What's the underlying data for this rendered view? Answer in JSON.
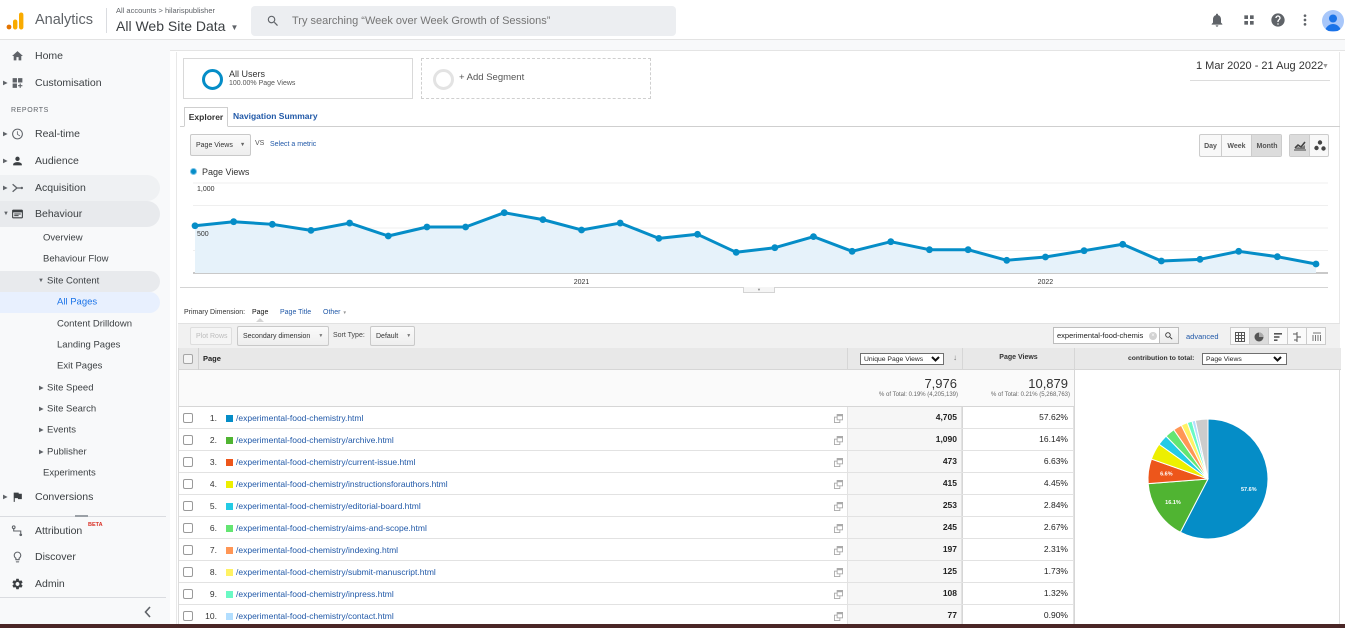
{
  "header": {
    "app_name": "Analytics",
    "breadcrumb": "All accounts > hilarispublisher",
    "property": "All Web Site Data",
    "search_placeholder": "Try searching “Week over Week Growth of Sessions”"
  },
  "sidebar": {
    "items": {
      "home": "Home",
      "customisation": "Customisation",
      "reports_heading": "REPORTS",
      "realtime": "Real-time",
      "audience": "Audience",
      "acquisition": "Acquisition",
      "behaviour": "Behaviour",
      "overview": "Overview",
      "behaviour_flow": "Behaviour Flow",
      "site_content": "Site Content",
      "all_pages": "All Pages",
      "content_drilldown": "Content Drilldown",
      "landing_pages": "Landing Pages",
      "exit_pages": "Exit Pages",
      "site_speed": "Site Speed",
      "site_search": "Site Search",
      "events": "Events",
      "publisher": "Publisher",
      "experiments": "Experiments",
      "conversions": "Conversions",
      "attribution": "Attribution",
      "attribution_badge": "BETA",
      "discover": "Discover",
      "admin": "Admin"
    },
    "active": "All Pages"
  },
  "report": {
    "segments": {
      "primary_name": "All Users",
      "primary_sub": "100.00% Page Views",
      "add": "+ Add Segment"
    },
    "date_range": "1 Mar 2020 - 21 Aug 2022",
    "tabs": [
      {
        "label": "Explorer",
        "active": true
      },
      {
        "label": "Navigation Summary",
        "active": false
      }
    ],
    "metric": {
      "selected": "Page Views",
      "vs": "VS",
      "select_metric": "Select a metric"
    },
    "granularity": {
      "options": [
        "Day",
        "Week",
        "Month"
      ],
      "active": "Month"
    },
    "legend": "Page Views",
    "primary_dimension": {
      "label": "Primary Dimension:",
      "selected": "Page",
      "page_title": "Page Title",
      "other": "Other"
    },
    "toolbar": {
      "plot_rows": "Plot Rows",
      "secondary_dimension": "Secondary dimension",
      "sort_type_label": "Sort Type:",
      "sort_type": "Default",
      "filter_value": "experimental-food-chemis",
      "advanced": "advanced"
    },
    "table": {
      "columns": {
        "page": "Page",
        "unique_page_views": "Unique Page Views",
        "page_views": "Page Views",
        "contribution_label": "contribution to total:",
        "contribution_metric": "Page Views"
      },
      "totals": {
        "unique_page_views": "7,976",
        "unique_page_views_pct": "% of Total: 0.19% (4,205,139)",
        "page_views": "10,879",
        "page_views_pct": "% of Total: 0.21% (5,268,763)"
      },
      "rows": [
        {
          "rank": "1.",
          "page": "/experimental-food-chemistry.html",
          "unique_page_views": "4,705",
          "contribution": "57.62%",
          "color": "#058dc7"
        },
        {
          "rank": "2.",
          "page": "/experimental-food-chemistry/archive.html",
          "unique_page_views": "1,090",
          "contribution": "16.14%",
          "color": "#50b432"
        },
        {
          "rank": "3.",
          "page": "/experimental-food-chemistry/current-issue.html",
          "unique_page_views": "473",
          "contribution": "6.63%",
          "color": "#ed561b"
        },
        {
          "rank": "4.",
          "page": "/experimental-food-chemistry/instructionsforauthors.html",
          "unique_page_views": "415",
          "contribution": "4.45%",
          "color": "#edef00"
        },
        {
          "rank": "5.",
          "page": "/experimental-food-chemistry/editorial-board.html",
          "unique_page_views": "253",
          "contribution": "2.84%",
          "color": "#24cbe5"
        },
        {
          "rank": "6.",
          "page": "/experimental-food-chemistry/aims-and-scope.html",
          "unique_page_views": "245",
          "contribution": "2.67%",
          "color": "#64e572"
        },
        {
          "rank": "7.",
          "page": "/experimental-food-chemistry/indexing.html",
          "unique_page_views": "197",
          "contribution": "2.31%",
          "color": "#ff9655"
        },
        {
          "rank": "8.",
          "page": "/experimental-food-chemistry/submit-manuscript.html",
          "unique_page_views": "125",
          "contribution": "1.73%",
          "color": "#fff263"
        },
        {
          "rank": "9.",
          "page": "/experimental-food-chemistry/inpress.html",
          "unique_page_views": "108",
          "contribution": "1.32%",
          "color": "#6af9c4"
        },
        {
          "rank": "10.",
          "page": "/experimental-food-chemistry/contact.html",
          "unique_page_views": "77",
          "contribution": "0.90%",
          "color": "#b2deff"
        }
      ]
    }
  },
  "colors": {
    "accent": "#058dc7",
    "nav_active": "#1a73e8",
    "link": "#2159a8"
  },
  "chart_data": [
    {
      "type": "line",
      "title": "",
      "xlabel": "",
      "ylabel": "",
      "granularity": "Month",
      "series": [
        {
          "name": "Page Views",
          "color": "#058dc7",
          "values": [
            525,
            570,
            541,
            474,
            555,
            411,
            511,
            511,
            670,
            593,
            478,
            555,
            385,
            430,
            230,
            281,
            404,
            241,
            348,
            259,
            259,
            141,
            178,
            248,
            319,
            133,
            152,
            241,
            181,
            100
          ]
        }
      ],
      "x_ticks": [
        {
          "index": 10,
          "label": "2021"
        },
        {
          "index": 22,
          "label": "2022"
        }
      ],
      "y_ticks": [
        {
          "value": 1000,
          "label": "1,000"
        },
        {
          "value": 500,
          "label": "500"
        }
      ],
      "y_gridlines": [
        0,
        250,
        500,
        750,
        1000
      ],
      "ylim": [
        0,
        1000
      ],
      "grid": true,
      "legend": "top-left"
    },
    {
      "type": "pie",
      "title": "contribution to total: Page Views",
      "categories": [
        "/experimental-food-chemistry.html",
        "/experimental-food-chemistry/archive.html",
        "/experimental-food-chemistry/current-issue.html",
        "/experimental-food-chemistry/instructionsforauthors.html",
        "/experimental-food-chemistry/editorial-board.html",
        "/experimental-food-chemistry/aims-and-scope.html",
        "/experimental-food-chemistry/indexing.html",
        "/experimental-food-chemistry/submit-manuscript.html",
        "/experimental-food-chemistry/inpress.html",
        "/experimental-food-chemistry/contact.html",
        "(other)"
      ],
      "values": [
        57.62,
        16.14,
        6.63,
        4.45,
        2.84,
        2.67,
        2.31,
        1.73,
        1.32,
        0.9,
        3.39
      ],
      "colors": [
        "#058dc7",
        "#50b432",
        "#ed561b",
        "#edef00",
        "#24cbe5",
        "#64e572",
        "#ff9655",
        "#fff263",
        "#6af9c4",
        "#b2deff",
        "#cccccc"
      ],
      "slice_labels": [
        "57.6%",
        "16.1%",
        "6.6%",
        null,
        null,
        null,
        null,
        null,
        null,
        null,
        null
      ]
    }
  ]
}
